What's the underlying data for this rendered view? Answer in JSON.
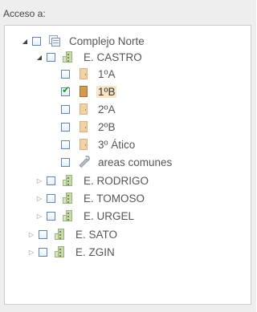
{
  "panel": {
    "title": "Acceso a:"
  },
  "tree": {
    "root": {
      "label": "Complejo Norte",
      "icon": "complex-icon",
      "expanded": true,
      "checked": false
    },
    "castro": {
      "label": "E. CASTRO",
      "icon": "building-icon",
      "expanded": true,
      "checked": false,
      "children": [
        {
          "label": "1ºA",
          "icon": "door-icon",
          "checked": false,
          "selected": false
        },
        {
          "label": "1ºB",
          "icon": "door-icon",
          "checked": true,
          "selected": true
        },
        {
          "label": "2ºA",
          "icon": "door-icon",
          "checked": false,
          "selected": false
        },
        {
          "label": "2ºB",
          "icon": "door-icon",
          "checked": false,
          "selected": false
        },
        {
          "label": "3º Ático",
          "icon": "door-icon",
          "checked": false,
          "selected": false
        },
        {
          "label": "areas comunes",
          "icon": "wrench-icon",
          "checked": false,
          "selected": false
        }
      ]
    },
    "rodrigo": {
      "label": "E. RODRIGO",
      "icon": "building-icon",
      "expanded": false,
      "checked": false
    },
    "tomoso": {
      "label": "E. TOMOSO",
      "icon": "building-icon",
      "expanded": false,
      "checked": false
    },
    "urgel": {
      "label": "E. URGEL",
      "icon": "building-icon",
      "expanded": false,
      "checked": false
    },
    "sato": {
      "label": "E. SATO",
      "icon": "building-icon",
      "expanded": false,
      "checked": false
    },
    "zgin": {
      "label": "E. ZGIN",
      "icon": "building-icon",
      "expanded": false,
      "checked": false
    }
  },
  "glyphs": {
    "expanded": "◢",
    "collapsed": "▷",
    "checkmark": "✔"
  },
  "colors": {
    "selection_bg": "#f8e5c6",
    "check_green": "#1e9e1e",
    "checkbox_border": "#5a86b8"
  }
}
